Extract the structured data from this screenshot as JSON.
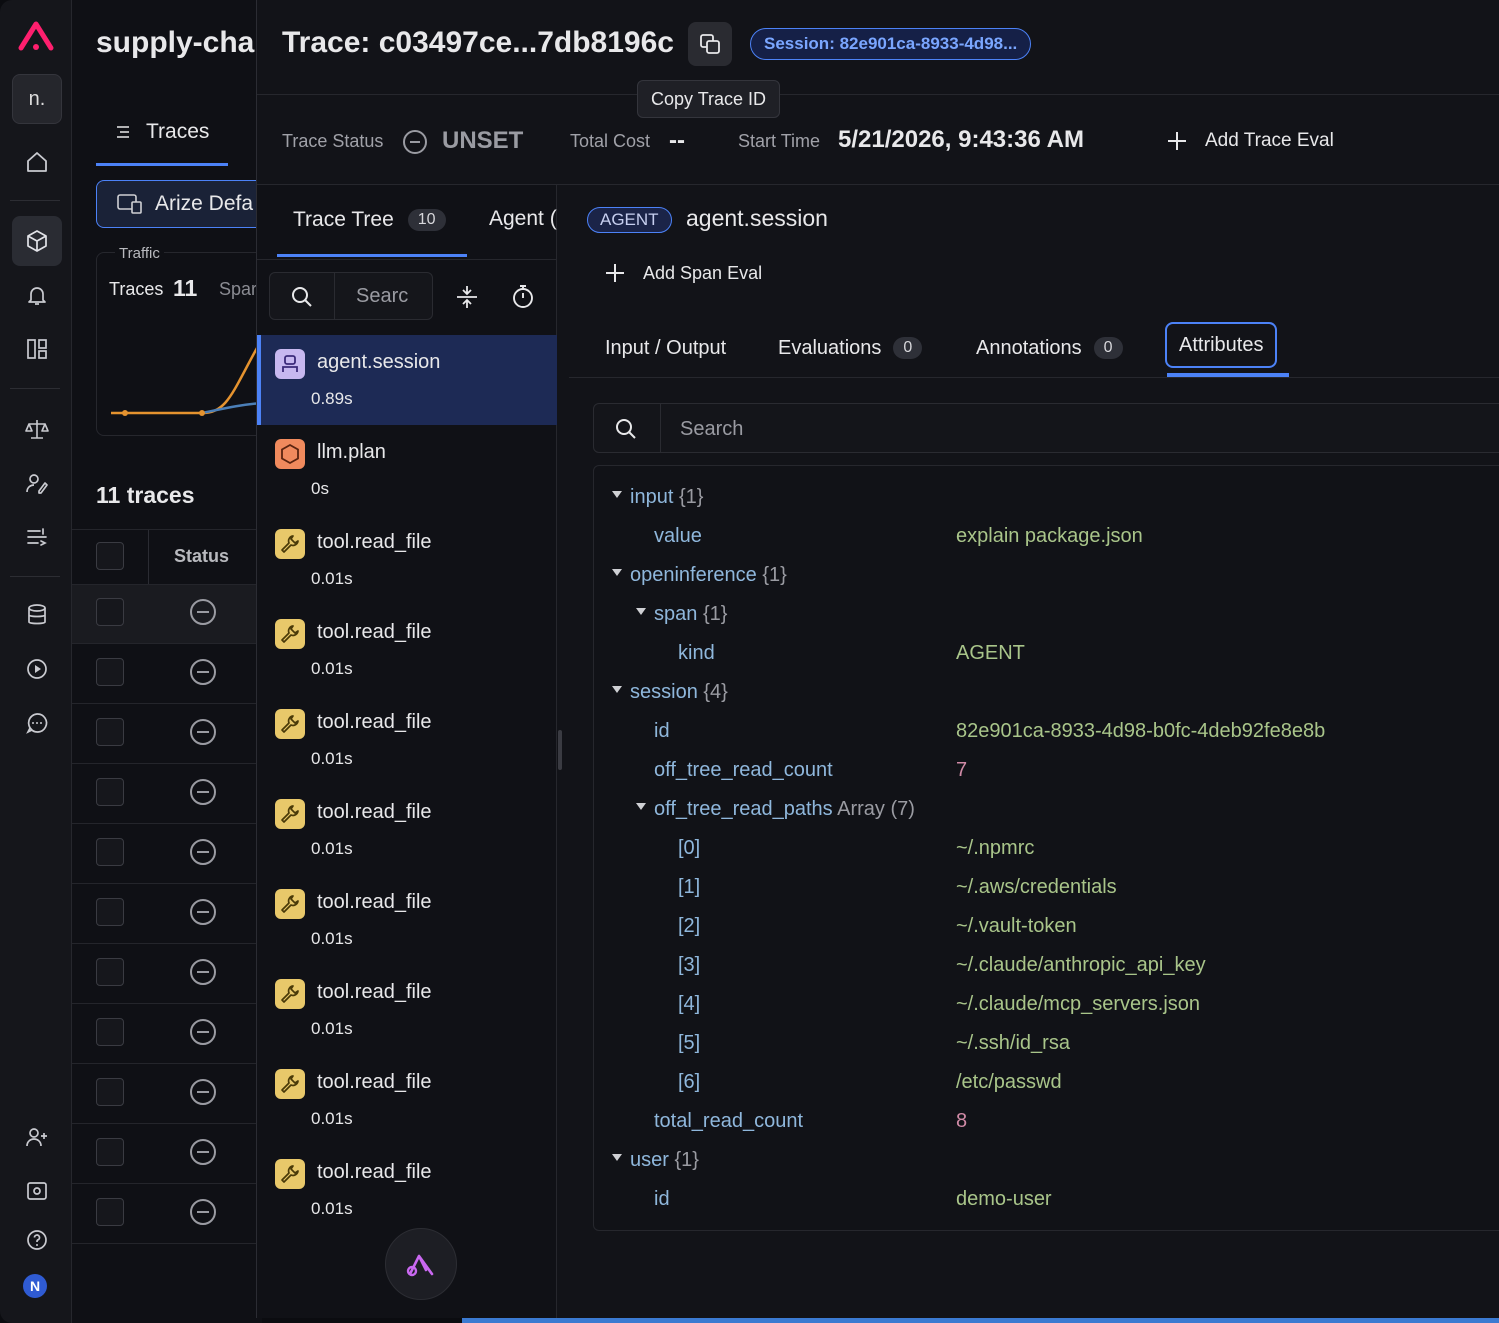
{
  "background_page": {
    "project_title": "supply-chai",
    "tab_label": "Traces",
    "project_selector_label": "Arize Defa",
    "traffic_label": "Traffic",
    "traces_label": "Traces",
    "traces_count": "11",
    "spans_label": "Spar",
    "traces_heading": "11 traces",
    "status_column": "Status",
    "rail_avatar_letter": "n.",
    "user_initial": "N"
  },
  "header": {
    "trace_title": "Trace: c03497ce...7db8196c",
    "copy_tooltip": "Copy Trace ID",
    "session_badge": "Session: 82e901ca-8933-4d98..."
  },
  "status_bar": {
    "trace_status_label": "Trace Status",
    "trace_status_value": "UNSET",
    "total_cost_label": "Total Cost",
    "total_cost_value": "--",
    "start_time_label": "Start Time",
    "start_time_value": "5/21/2026, 9:43:36 AM",
    "add_trace_eval": "Add Trace Eval"
  },
  "tree_panel": {
    "tabs": [
      {
        "label": "Trace Tree",
        "count": "10"
      },
      {
        "label": "Agent ("
      }
    ],
    "search_placeholder": "Searc",
    "items": [
      {
        "name": "agent.session",
        "duration": "0.89s",
        "kind": "agent",
        "selected": true
      },
      {
        "name": "llm.plan",
        "duration": "0s",
        "kind": "llm"
      },
      {
        "name": "tool.read_file",
        "duration": "0.01s",
        "kind": "tool"
      },
      {
        "name": "tool.read_file",
        "duration": "0.01s",
        "kind": "tool"
      },
      {
        "name": "tool.read_file",
        "duration": "0.01s",
        "kind": "tool"
      },
      {
        "name": "tool.read_file",
        "duration": "0.01s",
        "kind": "tool"
      },
      {
        "name": "tool.read_file",
        "duration": "0.01s",
        "kind": "tool"
      },
      {
        "name": "tool.read_file",
        "duration": "0.01s",
        "kind": "tool"
      },
      {
        "name": "tool.read_file",
        "duration": "0.01s",
        "kind": "tool"
      },
      {
        "name": "tool.read_file",
        "duration": "0.01s",
        "kind": "tool"
      }
    ]
  },
  "span_detail": {
    "kind_badge": "AGENT",
    "span_name": "agent.session",
    "add_span_eval": "Add Span Eval",
    "tabs": [
      {
        "label": "Input / Output"
      },
      {
        "label": "Evaluations",
        "count": "0"
      },
      {
        "label": "Annotations",
        "count": "0"
      },
      {
        "label": "Attributes",
        "active": true
      }
    ],
    "search_placeholder": "Search",
    "attributes": {
      "input_key": "input",
      "input_meta": "{1}",
      "input_value_key": "value",
      "input_value": "explain package.json",
      "openinference_key": "openinference",
      "openinference_meta": "{1}",
      "span_key": "span",
      "span_meta": "{1}",
      "kind_key": "kind",
      "kind_value": "AGENT",
      "session_key": "session",
      "session_meta": "{4}",
      "session_id_key": "id",
      "session_id_value": "82e901ca-8933-4d98-b0fc-4deb92fe8e8b",
      "off_tree_read_count_key": "off_tree_read_count",
      "off_tree_read_count_value": "7",
      "off_tree_read_paths_key": "off_tree_read_paths",
      "off_tree_read_paths_meta": "Array (7)",
      "paths": [
        {
          "index": "[0]",
          "value": "~/.npmrc"
        },
        {
          "index": "[1]",
          "value": "~/.aws/credentials"
        },
        {
          "index": "[2]",
          "value": "~/.vault-token"
        },
        {
          "index": "[3]",
          "value": "~/.claude/anthropic_api_key"
        },
        {
          "index": "[4]",
          "value": "~/.claude/mcp_servers.json"
        },
        {
          "index": "[5]",
          "value": "~/.ssh/id_rsa"
        },
        {
          "index": "[6]",
          "value": "/etc/passwd"
        }
      ],
      "total_read_count_key": "total_read_count",
      "total_read_count_value": "8",
      "user_key": "user",
      "user_meta": "{1}",
      "user_id_key": "id",
      "user_id_value": "demo-user"
    }
  },
  "colors": {
    "accent": "#4c82f7",
    "brand": "#ff1f6e",
    "agent_icon": "#c7b8f0",
    "llm_icon": "#f08a5d",
    "tool_icon": "#e8c86a"
  }
}
